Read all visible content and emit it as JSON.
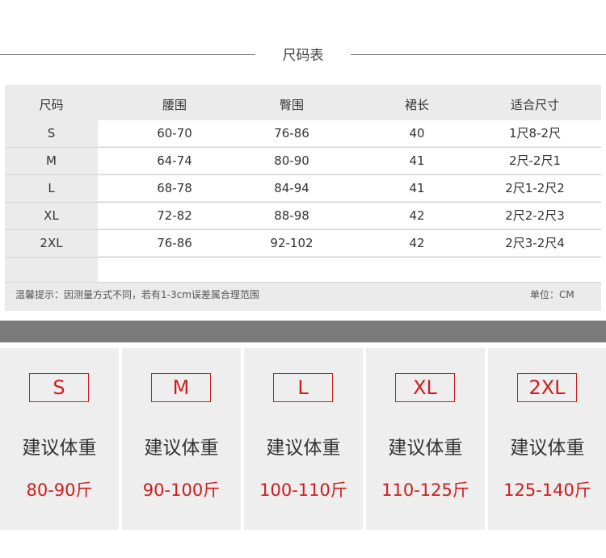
{
  "title": "尺码表",
  "table": {
    "headers": [
      "尺码",
      "腰围",
      "臀围",
      "裙长",
      "适合尺寸"
    ],
    "rows": [
      [
        "S",
        "60-70",
        "76-86",
        "40",
        "1尺8-2尺"
      ],
      [
        "M",
        "64-74",
        "80-90",
        "41",
        "2尺-2尺1"
      ],
      [
        "L",
        "68-78",
        "84-94",
        "41",
        "2尺1-2尺2"
      ],
      [
        "XL",
        "72-82",
        "88-98",
        "42",
        "2尺2-2尺3"
      ],
      [
        "2XL",
        "76-86",
        "92-102",
        "42",
        "2尺3-2尺4"
      ]
    ]
  },
  "note": "温馨提示：因测量方式不同，若有1-3cm误差属合理范围",
  "unit": "单位：CM",
  "cards": [
    {
      "size": "S",
      "advice": "建议体重",
      "weight": "80-90斤"
    },
    {
      "size": "M",
      "advice": "建议体重",
      "weight": "90-100斤"
    },
    {
      "size": "L",
      "advice": "建议体重",
      "weight": "100-110斤"
    },
    {
      "size": "XL",
      "advice": "建议体重",
      "weight": "110-125斤"
    },
    {
      "size": "2XL",
      "advice": "建议体重",
      "weight": "125-140斤"
    }
  ],
  "colors": {
    "accent": "#cf1d1d",
    "table_bg": "#ebebeb",
    "band": "#7a7a7a",
    "card_bg": "#eeeeee"
  }
}
